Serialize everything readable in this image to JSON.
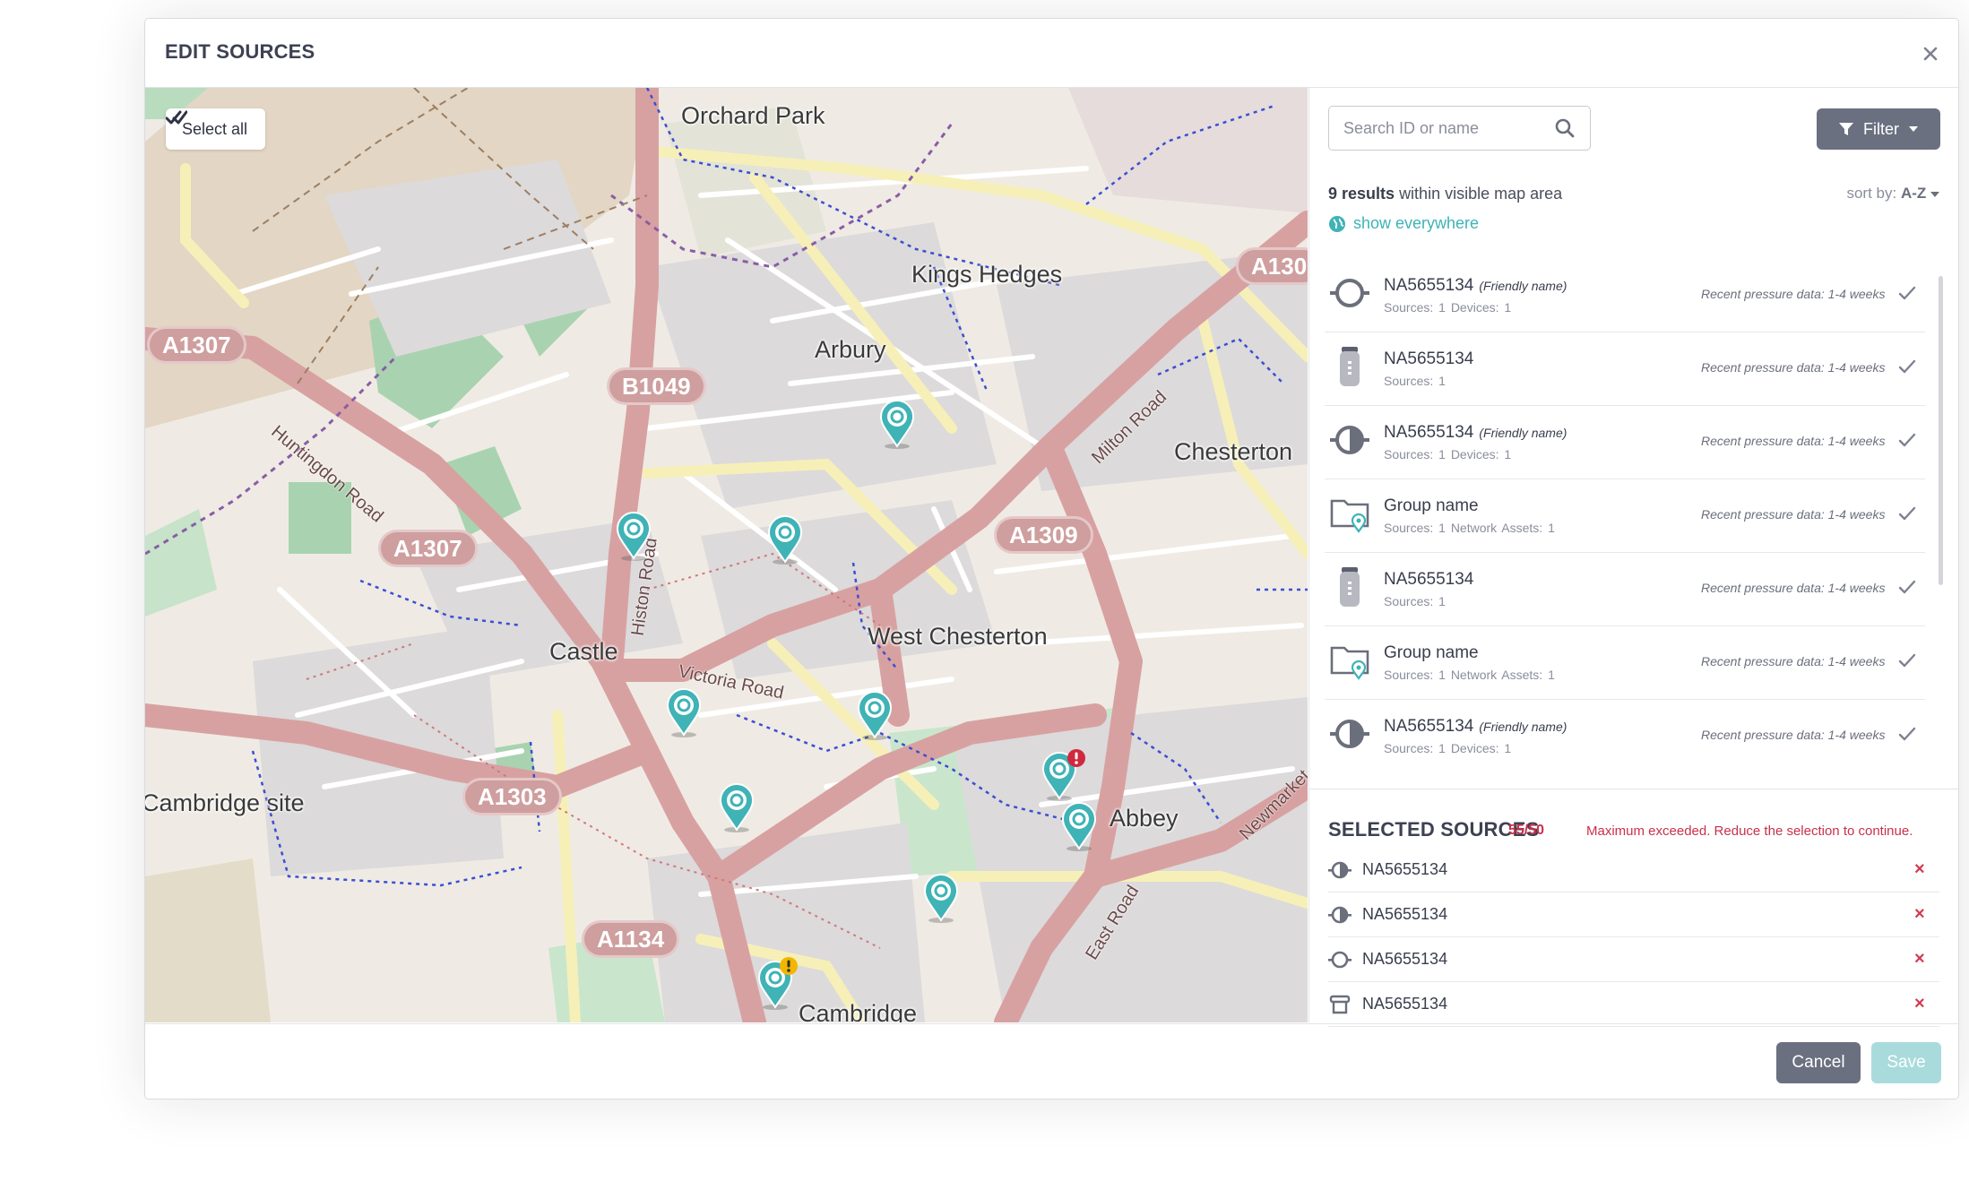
{
  "modal": {
    "title": "EDIT SOURCES"
  },
  "map": {
    "select_all_label": "Select all",
    "places": [
      "Orchard Park",
      "Kings Hedges",
      "Arbury",
      "Chesterton",
      "West Chesterton",
      "Castle",
      "Abbey",
      "Cambridge site",
      "Cambridge"
    ],
    "roads": [
      "Huntingdon Road",
      "Histon Road",
      "Victoria Road",
      "Milton Road",
      "East Road",
      "Newmarket"
    ],
    "shields": [
      "A1307",
      "A1307",
      "B1049",
      "A1309",
      "A1303",
      "A1134",
      "A130"
    ],
    "colors": {
      "pin": "#3fb3b6",
      "alert_red": "#d0283e",
      "alert_yellow": "#f2b600"
    }
  },
  "search": {
    "placeholder": "Search ID or name"
  },
  "filter": {
    "label": "Filter"
  },
  "results": {
    "count": "9 results",
    "suffix": "within visible map area",
    "show_everywhere": "show everywhere"
  },
  "sort": {
    "label": "sort by:",
    "value": "A-Z"
  },
  "sources": [
    {
      "icon": "ring-icon",
      "name": "NA5655134",
      "friendly": "(Friendly name)",
      "meta": "Sources: 1   Devices: 1",
      "recent": "Recent pressure data: 1-4 weeks"
    },
    {
      "icon": "logger-device-icon",
      "name": "NA5655134",
      "friendly": "",
      "meta": "Sources: 1",
      "recent": "Recent pressure data: 1-4 weeks"
    },
    {
      "icon": "half-disc-icon",
      "name": "NA5655134",
      "friendly": "(Friendly name)",
      "meta": "Sources: 1   Devices: 1",
      "recent": "Recent pressure data: 1-4 weeks"
    },
    {
      "icon": "folder-pin-icon",
      "name": "Group name",
      "friendly": "",
      "meta": "Sources: 1   Network Assets: 1",
      "recent": "Recent pressure data: 1-4 weeks"
    },
    {
      "icon": "logger-device-icon",
      "name": "NA5655134",
      "friendly": "",
      "meta": "Sources: 1",
      "recent": "Recent pressure data: 1-4 weeks"
    },
    {
      "icon": "folder-pin-icon",
      "name": "Group name",
      "friendly": "",
      "meta": "Sources: 1   Network Assets: 1",
      "recent": "Recent pressure data: 1-4 weeks"
    },
    {
      "icon": "half-disc-icon",
      "name": "NA5655134",
      "friendly": "(Friendly name)",
      "meta": "Sources: 1   Devices: 1",
      "recent": "Recent pressure data: 1-4 weeks"
    }
  ],
  "selected": {
    "title": "SELECTED SOURCES",
    "count": "55/50",
    "warning": "Maximum exceeded. Reduce the selection to continue.",
    "items": [
      {
        "icon": "half-disc-icon",
        "name": "NA5655134"
      },
      {
        "icon": "half-disc-icon",
        "name": "NA5655134"
      },
      {
        "icon": "ring-icon",
        "name": "NA5655134"
      },
      {
        "icon": "hydrant-icon",
        "name": "NA5655134"
      }
    ]
  },
  "footer": {
    "cancel": "Cancel",
    "save": "Save"
  }
}
